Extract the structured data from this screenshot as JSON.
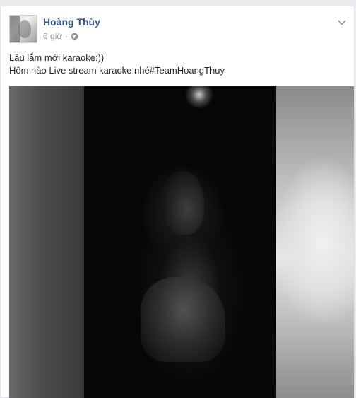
{
  "post": {
    "author": "Hoàng Thùy",
    "time": "6 giờ",
    "separator": "·",
    "privacy_icon": "globe-icon",
    "menu_icon": "chevron-down-icon",
    "text_line_1": "Lâu lắm mới karaoke:))",
    "text_line_2": "Hôm nào Live stream karaoke nhé#TeamHoangThuy"
  },
  "colors": {
    "author_link": "#365899",
    "meta_gray": "#90949c",
    "text": "#1d2129"
  }
}
